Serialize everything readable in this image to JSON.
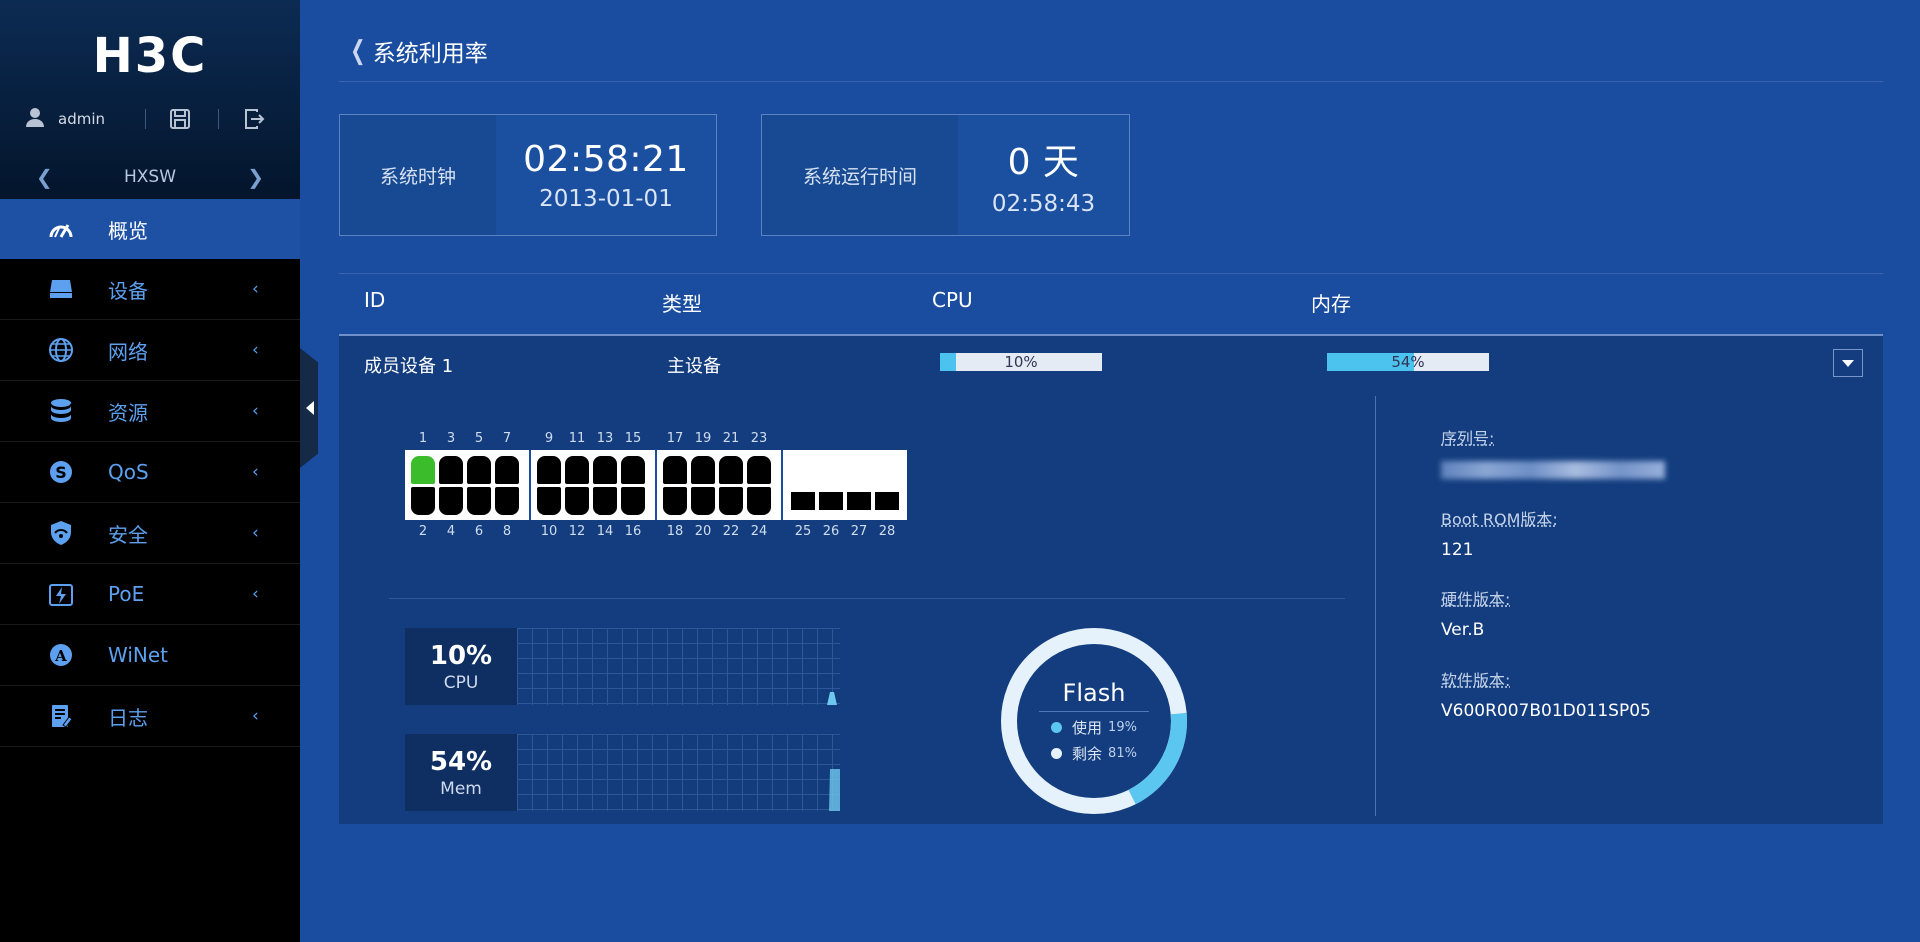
{
  "brand": {
    "logo_text": "H3C"
  },
  "user": {
    "name": "admin"
  },
  "device_selector": {
    "name": "HXSW"
  },
  "menu": [
    {
      "label": "概览",
      "icon": "dashboard-icon",
      "active": true,
      "has_chevron": false
    },
    {
      "label": "设备",
      "icon": "device-icon",
      "has_chevron": true
    },
    {
      "label": "网络",
      "icon": "globe-icon",
      "has_chevron": true
    },
    {
      "label": "资源",
      "icon": "database-icon",
      "has_chevron": true
    },
    {
      "label": "QoS",
      "icon": "qos-icon",
      "has_chevron": true
    },
    {
      "label": "安全",
      "icon": "shield-icon",
      "has_chevron": true
    },
    {
      "label": "PoE",
      "icon": "poe-icon",
      "has_chevron": true
    },
    {
      "label": "WiNet",
      "icon": "winet-icon",
      "has_chevron": false
    },
    {
      "label": "日志",
      "icon": "log-icon",
      "has_chevron": true
    }
  ],
  "page": {
    "title": "系统利用率"
  },
  "clock": {
    "label": "系统时钟",
    "time": "02:58:21",
    "date": "2013-01-01"
  },
  "uptime": {
    "label": "系统运行时间",
    "days": "0 天",
    "time": "02:58:43"
  },
  "table": {
    "headers": {
      "id": "ID",
      "type": "类型",
      "cpu": "CPU",
      "mem": "内存"
    },
    "row": {
      "id": "成员设备 1",
      "type": "主设备",
      "cpu_text": "10%",
      "cpu_value": 10,
      "mem_text": "54%",
      "mem_value": 54
    }
  },
  "ports": {
    "groups": [
      {
        "top": [
          "1",
          "3",
          "5",
          "7"
        ],
        "bottom": [
          "2",
          "4",
          "6",
          "8"
        ]
      },
      {
        "top": [
          "9",
          "11",
          "13",
          "15"
        ],
        "bottom": [
          "10",
          "12",
          "14",
          "16"
        ]
      },
      {
        "top": [
          "17",
          "19",
          "21",
          "23"
        ],
        "bottom": [
          "18",
          "20",
          "22",
          "24"
        ]
      }
    ],
    "sfp": [
      "25",
      "26",
      "27",
      "28"
    ],
    "active_port": "1"
  },
  "cpu_chart": {
    "percent": "10%",
    "label": "CPU"
  },
  "mem_chart": {
    "percent": "54%",
    "label": "Mem"
  },
  "flash": {
    "title": "Flash",
    "used_label": "使用",
    "used_pct": "19%",
    "used_value": 19,
    "free_label": "剩余",
    "free_pct": "81%",
    "used_color": "#5bc6f0",
    "free_color": "#e6f2fb"
  },
  "info": {
    "serial_label": "序列号:",
    "bootrom_label": "Boot ROM版本:",
    "bootrom_value": "121",
    "hardware_label": "硬件版本:",
    "hardware_value": "Ver.B",
    "software_label": "软件版本:",
    "software_value": "V600R007B01D011SP05"
  }
}
